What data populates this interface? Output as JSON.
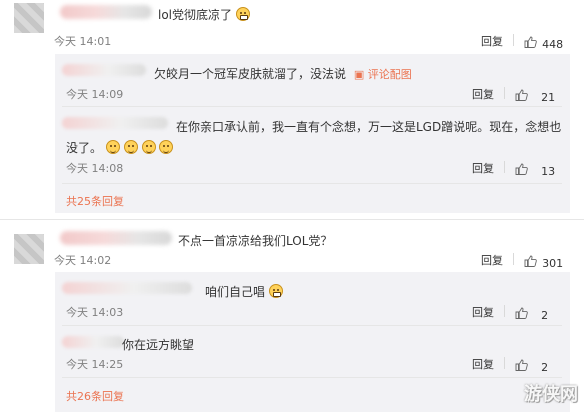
{
  "comments": [
    {
      "text": "lol党彻底凉了",
      "time": "今天 14:01",
      "reply_label": "回复",
      "likes": "448",
      "replies": [
        {
          "text": "欠皎月一个冠军皮肤就溜了，没法说",
          "pic_link": "评论配图",
          "time": "今天 14:09",
          "reply_label": "回复",
          "likes": "21"
        },
        {
          "text_line1": "在你亲口承认前，我一直有个念想，万一这是LGD蹭说呢。现在，念想也",
          "text_line2": "没了。",
          "time": "今天 14:08",
          "reply_label": "回复",
          "likes": "13"
        }
      ],
      "more": "共25条回复"
    },
    {
      "text": "不点一首凉凉给我们LOL党？",
      "time": "今天 14:02",
      "reply_label": "回复",
      "likes": "301",
      "replies": [
        {
          "text": "咱们自己唱",
          "time": "今天 14:03",
          "reply_label": "回复",
          "likes": "2"
        },
        {
          "text": "你在远方眺望",
          "time": "今天 14:25",
          "reply_label": "回复",
          "likes": "2"
        }
      ],
      "more": "共26条回复"
    }
  ],
  "watermark": "游侠网",
  "colors": {
    "accent": "#eb7350",
    "reply_bg": "#f2f2f5",
    "meta": "#808080"
  }
}
